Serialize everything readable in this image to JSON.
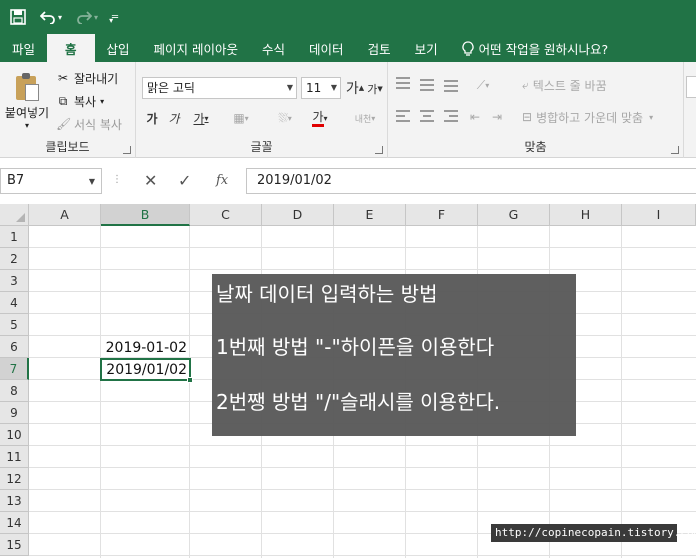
{
  "qat": {
    "save_icon": "save-icon",
    "undo_icon": "undo-icon",
    "redo_icon": "redo-icon",
    "customize_icon": "customize-qat-icon"
  },
  "tabs": [
    {
      "label": "파일"
    },
    {
      "label": "홈"
    },
    {
      "label": "삽입"
    },
    {
      "label": "페이지 레이아웃"
    },
    {
      "label": "수식"
    },
    {
      "label": "데이터"
    },
    {
      "label": "검토"
    },
    {
      "label": "보기"
    }
  ],
  "tell_me": "어떤 작업을 원하시나요?",
  "clipboard": {
    "paste": "붙여넣기",
    "cut": "잘라내기",
    "copy": "복사",
    "format_painter": "서식 복사",
    "label": "클립보드"
  },
  "font": {
    "name": "맑은 고딕",
    "size": "11",
    "grow": "가",
    "shrink": "가",
    "bold": "가",
    "italic": "가",
    "underline": "가",
    "color_letter": "가",
    "phonetic": "내천",
    "label": "글꼴"
  },
  "alignment": {
    "wrap": "텍스트 줄 바꿈",
    "merge": "병합하고 가운데 맞춤",
    "label": "맞춤"
  },
  "formula_bar": {
    "name_box": "B7",
    "fx": "fx",
    "value": "2019/01/02"
  },
  "columns": [
    "A",
    "B",
    "C",
    "D",
    "E",
    "F",
    "G",
    "H",
    "I"
  ],
  "rows": [
    "1",
    "2",
    "3",
    "4",
    "5",
    "6",
    "7",
    "8",
    "9",
    "10",
    "11",
    "12",
    "13",
    "14",
    "15"
  ],
  "cells": {
    "b6": "2019-01-02",
    "b7": "2019/01/02"
  },
  "note": {
    "line1": "날짜 데이터 입력하는 방법",
    "line2": "1번째 방법 \"-\"하이픈을 이용한다",
    "line3": "2번쨍 방법 \"/\"슬래시를 이용한다."
  },
  "watermark": "http://copinecopain.tistory.com",
  "colors": {
    "accent": "#217346",
    "note_bg": "#5a5a5a"
  }
}
